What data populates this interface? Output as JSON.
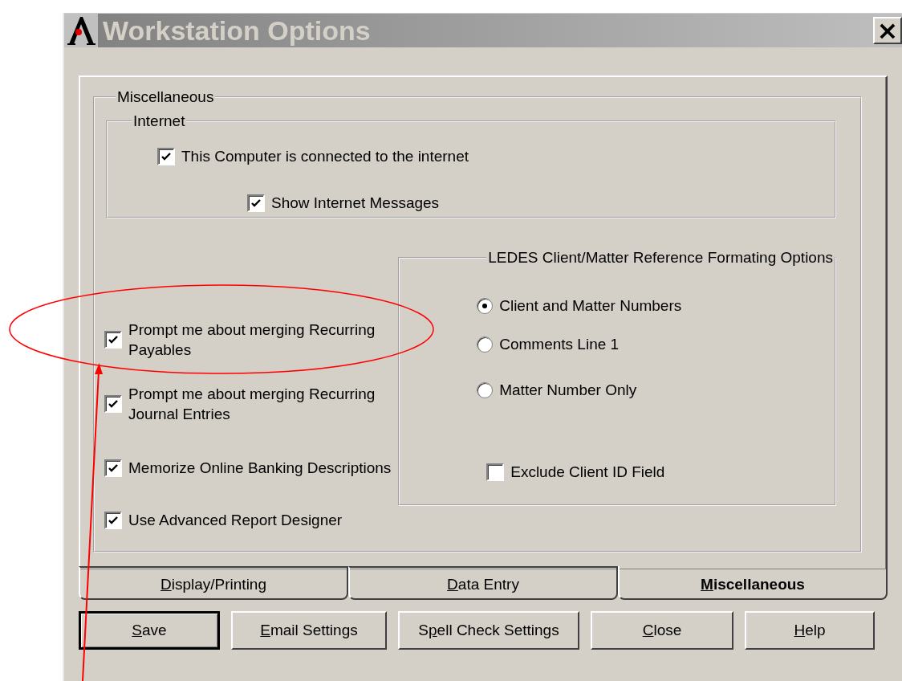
{
  "window": {
    "title": "Workstation Options",
    "close": "×"
  },
  "group": {
    "legend": "Miscellaneous",
    "internet": {
      "legend": "Internet",
      "options": [
        {
          "label": "This Computer is connected to the internet",
          "checked": true,
          "children": [
            {
              "label": "Show Internet Messages",
              "checked": true
            }
          ]
        }
      ]
    },
    "left_options": [
      {
        "label": "Prompt me about merging Recurring\nPayables",
        "checked": true
      },
      {
        "label": "Prompt me about merging Recurring\nJournal Entries",
        "checked": true
      },
      {
        "label": "Memorize Online Banking Descriptions",
        "checked": true
      },
      {
        "label": "Use Advanced Report Designer",
        "checked": true
      }
    ],
    "ledes": {
      "legend": "LEDES Client/Matter Reference Formating Options",
      "radios": [
        {
          "label": "Client and Matter Numbers",
          "selected": true
        },
        {
          "label": "Comments Line 1",
          "selected": false
        },
        {
          "label": "Matter Number Only",
          "selected": false
        }
      ],
      "checkbox": {
        "label": "Exclude Client ID Field",
        "checked": false
      }
    }
  },
  "tabs": [
    {
      "key": "D",
      "after": "isplay/Printing",
      "selected": false
    },
    {
      "key": "D",
      "after": "ata Entry",
      "selected": false
    },
    {
      "key": "M",
      "after": "iscellaneous",
      "selected": true
    }
  ],
  "buttons": [
    {
      "key": "S",
      "after": "ave",
      "default": true
    },
    {
      "key": "E",
      "after": "mail Settings",
      "default": false
    },
    {
      "before": "S",
      "key": "p",
      "after": "ell Check Settings",
      "default": false
    },
    {
      "key": "C",
      "after": "lose",
      "default": false
    },
    {
      "key": "H",
      "after": "elp",
      "default": false
    }
  ]
}
